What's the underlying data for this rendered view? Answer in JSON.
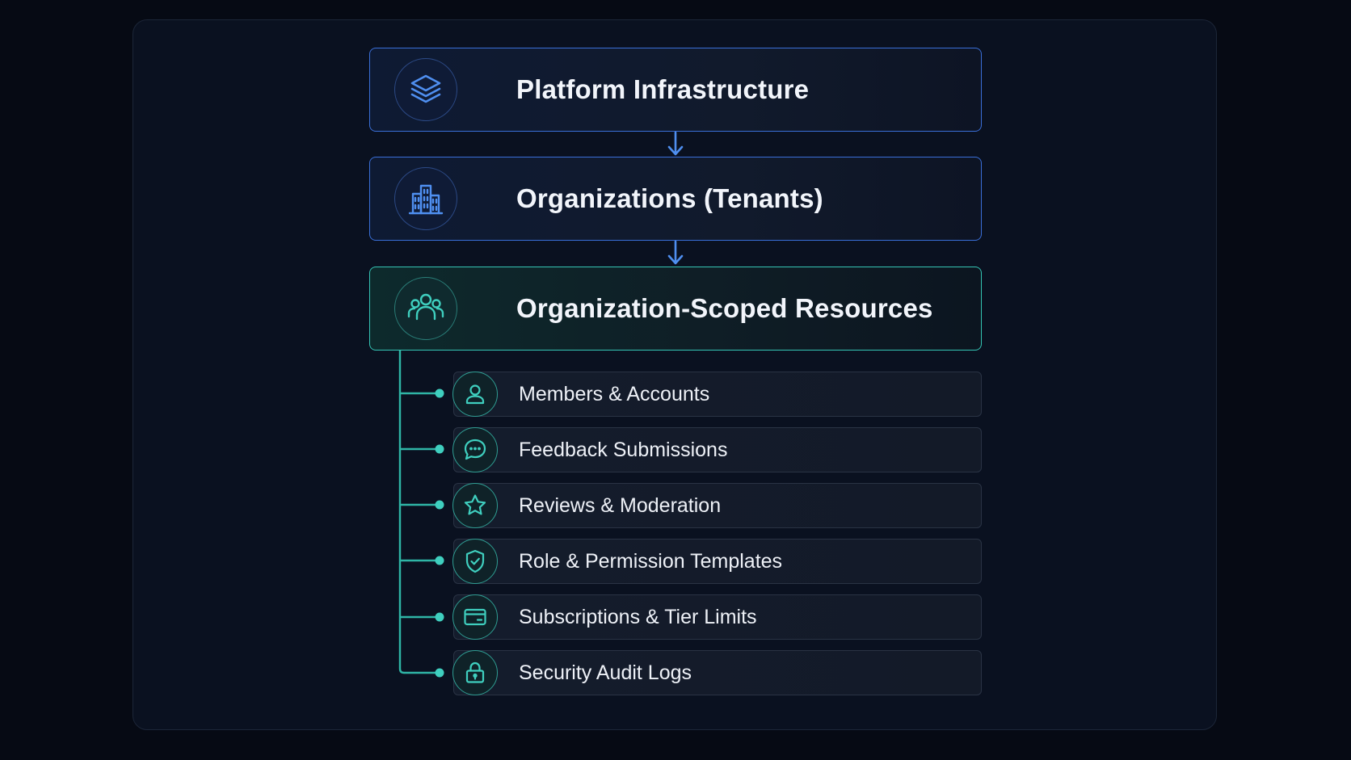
{
  "colors": {
    "background": "#060a14",
    "panel": "#0a1120",
    "tier_border_blue": "#3a6fd8",
    "tier_border_teal": "#35c4b4",
    "icon_blue": "#4f8ff0",
    "icon_teal": "#3fcfbf",
    "text": "#f2f5fb"
  },
  "tiers": [
    {
      "label": "Platform Infrastructure",
      "icon": "layers-icon"
    },
    {
      "label": "Organizations (Tenants)",
      "icon": "buildings-icon"
    },
    {
      "label": "Organization-Scoped Resources",
      "icon": "users-group-icon"
    }
  ],
  "resources": [
    {
      "label": "Members & Accounts",
      "icon": "user-icon"
    },
    {
      "label": "Feedback Submissions",
      "icon": "chat-bubble-icon"
    },
    {
      "label": "Reviews & Moderation",
      "icon": "star-icon"
    },
    {
      "label": "Role & Permission Templates",
      "icon": "shield-check-icon"
    },
    {
      "label": "Subscriptions & Tier Limits",
      "icon": "credit-card-icon"
    },
    {
      "label": "Security Audit Logs",
      "icon": "lock-icon"
    }
  ]
}
